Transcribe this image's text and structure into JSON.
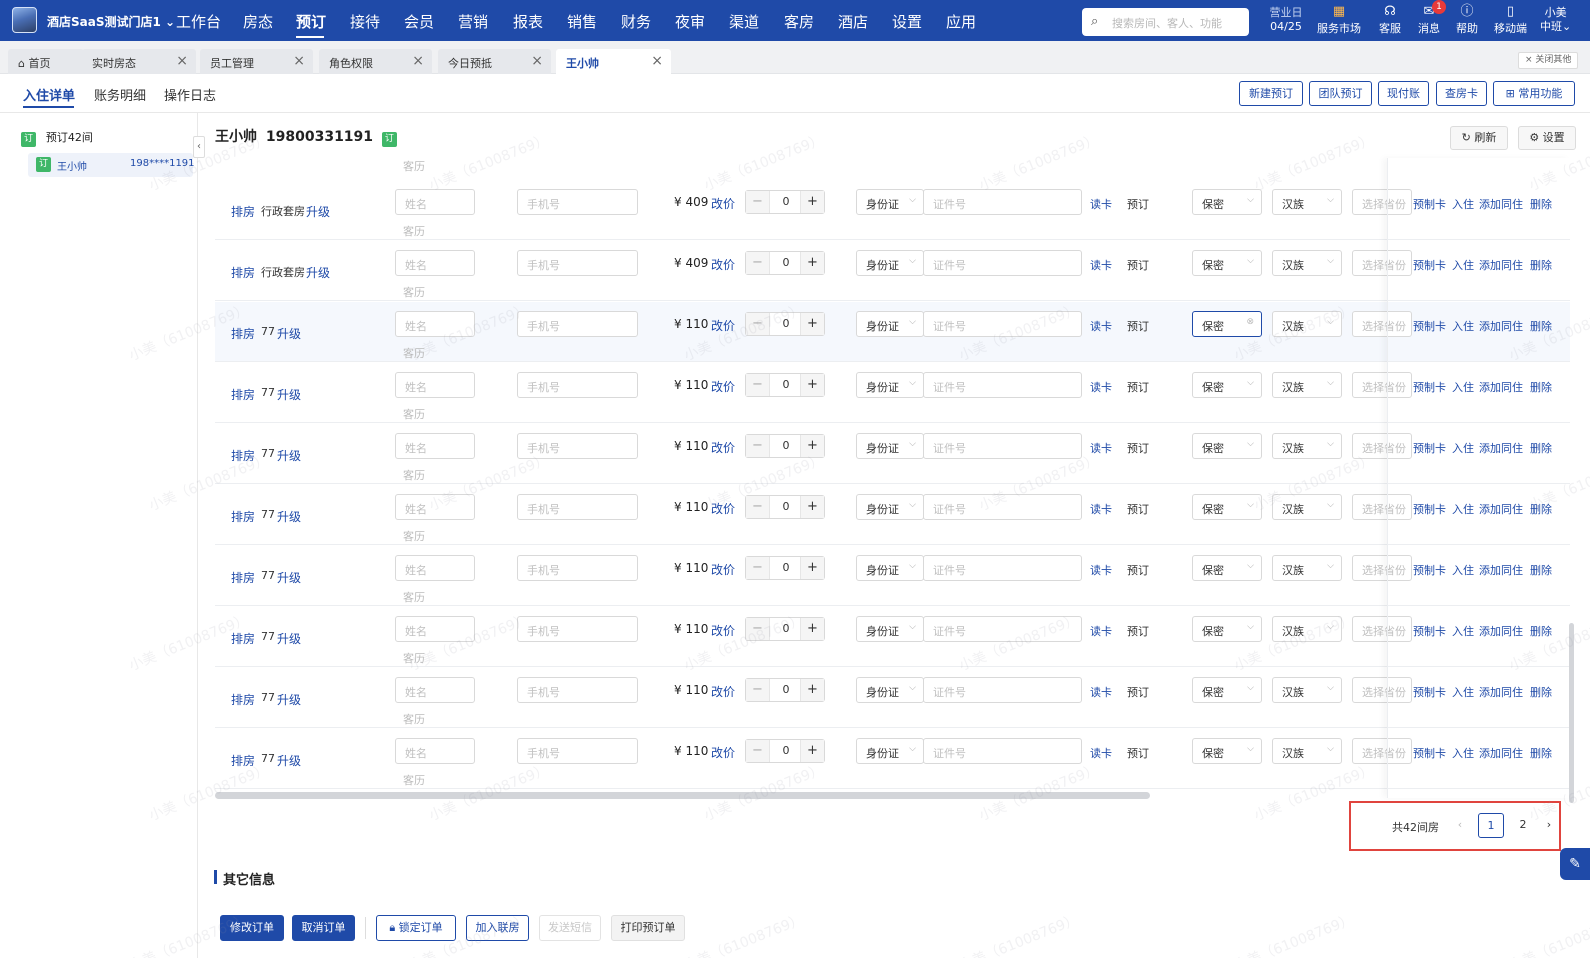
{
  "app": {
    "store_name": "酒店SaaS测试门店1"
  },
  "nav": [
    "工作台",
    "房态",
    "预订",
    "接待",
    "会员",
    "营销",
    "报表",
    "销售",
    "财务",
    "夜审",
    "渠道",
    "客房",
    "酒店",
    "设置",
    "应用"
  ],
  "search": {
    "placeholder": "搜索房间、客人、功能"
  },
  "business_day": {
    "label": "营业日",
    "date": "04/25"
  },
  "tools": {
    "market": "服务市场",
    "service": "客服",
    "messages": "消息",
    "messages_badge": "1",
    "help": "帮助",
    "mobile": "移动端"
  },
  "user": {
    "name": "小美",
    "shift": "中班"
  },
  "tabs": [
    "首页",
    "实时房态",
    "员工管理",
    "角色权限",
    "今日预抵",
    "王小帅"
  ],
  "close_others": "关闭其他",
  "subtabs": [
    "入住详单",
    "账务明细",
    "操作日志"
  ],
  "top_actions": [
    "新建预订",
    "团队预订",
    "现付账",
    "查房卡",
    "常用功能"
  ],
  "sidebar": {
    "tag": "订",
    "group_label": "预订42间",
    "guest_name": "王小帅",
    "guest_phone": "198****1191"
  },
  "guest": {
    "name": "王小帅",
    "phone": "19800331191",
    "tag": "订"
  },
  "header_actions": {
    "refresh": "刷新",
    "settings": "设置"
  },
  "row_labels": {
    "assign": "排房",
    "upgrade": "升级",
    "guest_type": "客历",
    "name_ph": "姓名",
    "phone_ph": "手机号",
    "change_price": "改价",
    "id_type": "身份证",
    "id_ph": "证件号",
    "read_card": "读卡",
    "status": "预订",
    "privacy": "保密",
    "ethnicity": "汉族",
    "region_ph": "选择省份",
    "make_card": "预制卡",
    "checkin": "入住",
    "add_companion": "添加同住",
    "delete": "删除"
  },
  "rows": [
    {
      "room": "行政套房",
      "price": "¥ 409",
      "count": "0"
    },
    {
      "room": "行政套房",
      "price": "¥ 409",
      "count": "0"
    },
    {
      "room": "77",
      "price": "¥ 110",
      "count": "0"
    },
    {
      "room": "77",
      "price": "¥ 110",
      "count": "0"
    },
    {
      "room": "77",
      "price": "¥ 110",
      "count": "0"
    },
    {
      "room": "77",
      "price": "¥ 110",
      "count": "0"
    },
    {
      "room": "77",
      "price": "¥ 110",
      "count": "0"
    },
    {
      "room": "77",
      "price": "¥ 110",
      "count": "0"
    },
    {
      "room": "77",
      "price": "¥ 110",
      "count": "0"
    },
    {
      "room": "77",
      "price": "¥ 110",
      "count": "0"
    }
  ],
  "pagination": {
    "total": "共42间房",
    "pages": [
      "1",
      "2"
    ],
    "current": "1"
  },
  "other_info": {
    "title": "其它信息"
  },
  "footer_actions": [
    "修改订单",
    "取消订单",
    "锁定订单",
    "加入联房",
    "发送短信",
    "打印预订单"
  ],
  "watermark": "小美（61008769）",
  "colors": {
    "primary": "#1f4aa8",
    "tag_green": "#3fb768",
    "highlight_red": "#e0443e"
  }
}
